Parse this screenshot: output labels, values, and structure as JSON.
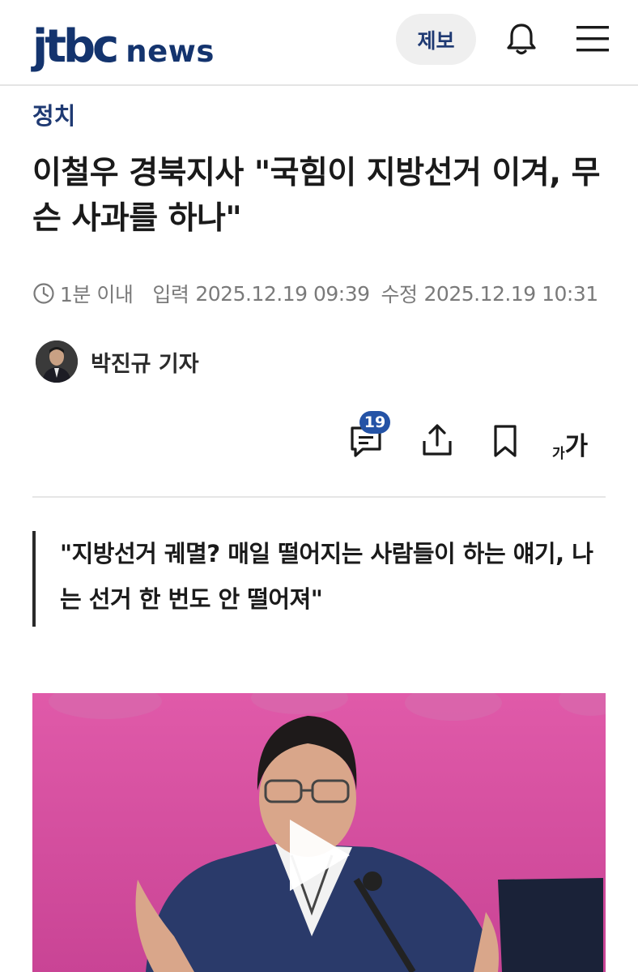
{
  "header": {
    "logo_main": "jtbc",
    "logo_sub": "news",
    "report_label": "제보",
    "bell_icon": "bell-icon",
    "menu_icon": "hamburger-menu-icon"
  },
  "article": {
    "category": "정치",
    "title": "이철우 경북지사 \"국힘이 지방선거 이겨, 무슨 사과를 하나\"",
    "read_time": "1분 이내",
    "published_label": "입력",
    "published": "2025.12.19 09:39",
    "updated_label": "수정",
    "updated": "2025.12.19 10:31",
    "reporter": "박진규 기자",
    "quote": "\"지방선거 궤멸? 매일 떨어지는 사람들이 하는 얘기, 나는 선거 한 번도 안 떨어져\""
  },
  "actions": {
    "comment_count": "19",
    "font_small": "가",
    "font_large": "가"
  },
  "colors": {
    "brand_navy": "#14346e",
    "category_blue": "#1f3a73",
    "badge_blue": "#2453a6",
    "photo_backdrop_pink": "#d84fa0"
  }
}
